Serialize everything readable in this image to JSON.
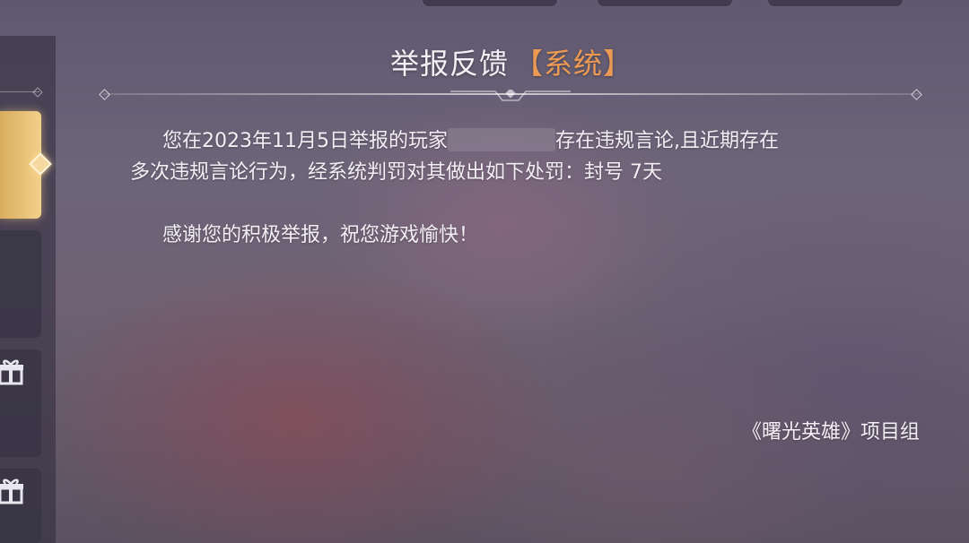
{
  "header": {
    "title": "举报反馈",
    "tag": "【系统】"
  },
  "message": {
    "line1_prefix": "您在2023年11月5日举报的玩家",
    "line1_suffix": "存在违规言论,且近期存在",
    "line2": "多次违规言论行为，经系统判罚对其做出如下处罚：封号 7天",
    "thanks": "感谢您的积极举报，祝您游戏愉快！",
    "signature": "《曙光英雄》项目组"
  },
  "sidebar": {
    "icons": [
      "diamond-marker-icon",
      "gift-icon",
      "gift-icon"
    ]
  },
  "colors": {
    "accent": "#ec9a53",
    "active_tab": "#e9c27a",
    "text": "#f3eff5"
  }
}
